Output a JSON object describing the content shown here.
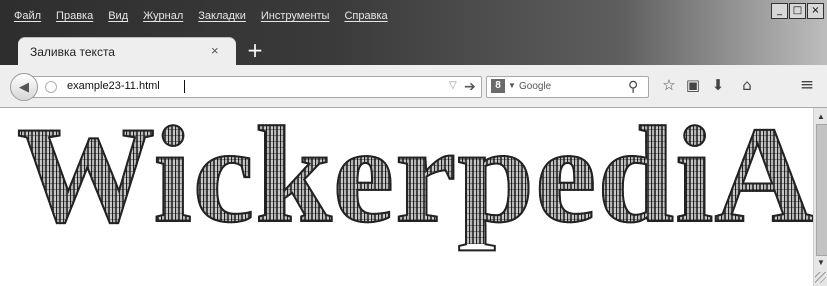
{
  "menubar": {
    "items": [
      "Файл",
      "Правка",
      "Вид",
      "Журнал",
      "Закладки",
      "Инструменты",
      "Справка"
    ]
  },
  "window_controls": {
    "minimize": "_",
    "maximize": "□",
    "close": "×"
  },
  "tab": {
    "title": "Заливка текста",
    "close": "×",
    "new_tab": "+"
  },
  "navbar": {
    "url": "example23-11.html",
    "search_placeholder": "Google",
    "search_engine_letter": "8"
  },
  "content": {
    "wordmark": "WickerpediA"
  },
  "icons": {
    "back": "back-arrow-icon",
    "bookmark": "star-icon",
    "library": "clipboard-icon",
    "downloads": "download-icon",
    "home": "home-icon",
    "menu": "hamburger-icon"
  }
}
